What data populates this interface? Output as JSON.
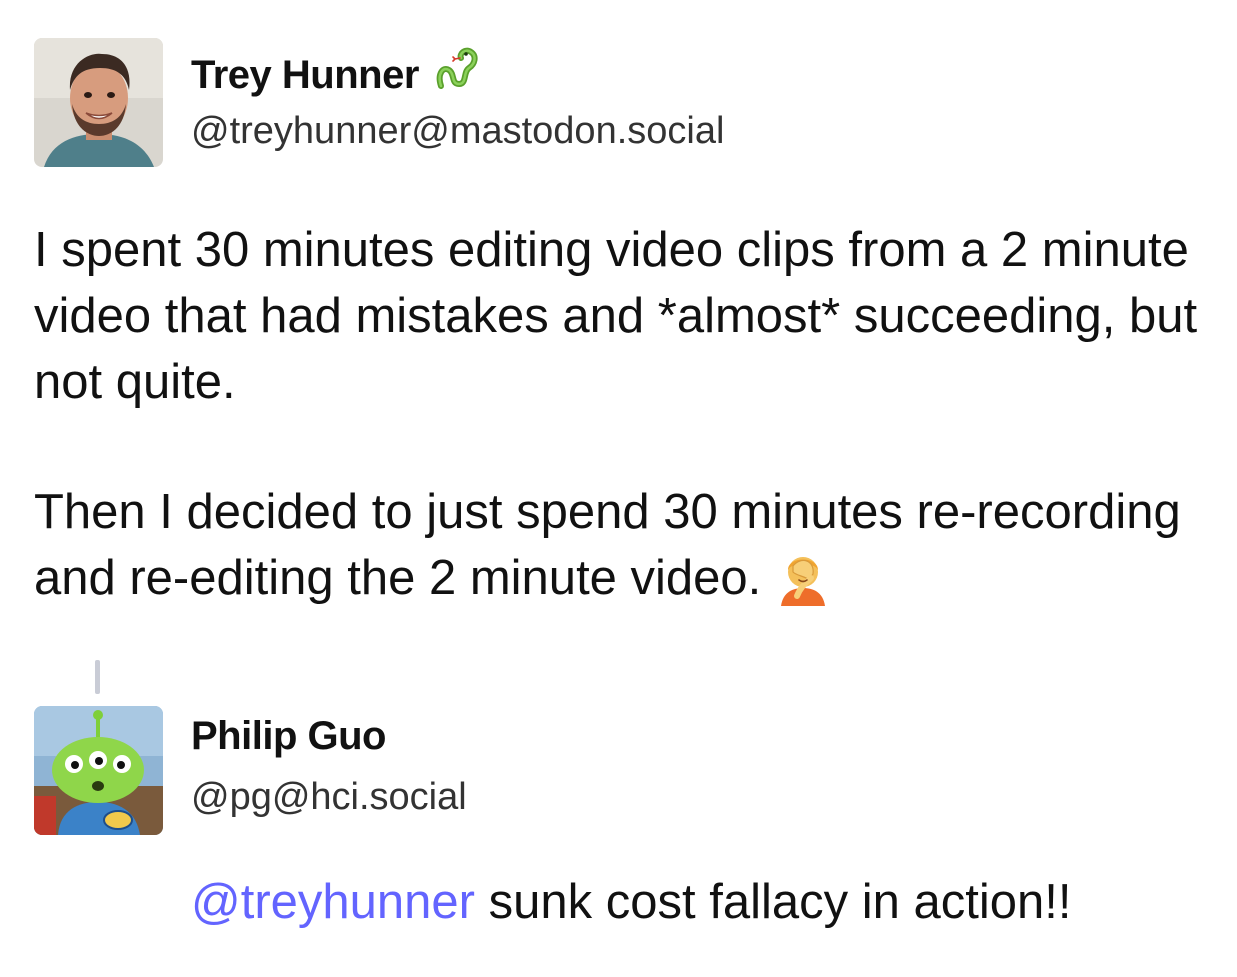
{
  "original_post": {
    "display_name": "Trey Hunner",
    "handle": "@treyhunner@mastodon.social",
    "badge_icon": "snake-icon",
    "paragraphs": [
      "I spent 30 minutes editing video clips from a 2 minute video that had mistakes and *almost* succeeding, but not quite.",
      "Then I decided to just spend 30 minutes re-recording and re-editing the 2 minute video."
    ],
    "end_emoji": "facepalm-icon"
  },
  "reply": {
    "display_name": "Philip Guo",
    "handle": "@pg@hci.social",
    "mention": "@treyhunner",
    "text": " sunk cost fallacy in action!!"
  },
  "colors": {
    "mention": "#6364ff",
    "thread_line": "#c9ccd6",
    "text": "#111111"
  }
}
